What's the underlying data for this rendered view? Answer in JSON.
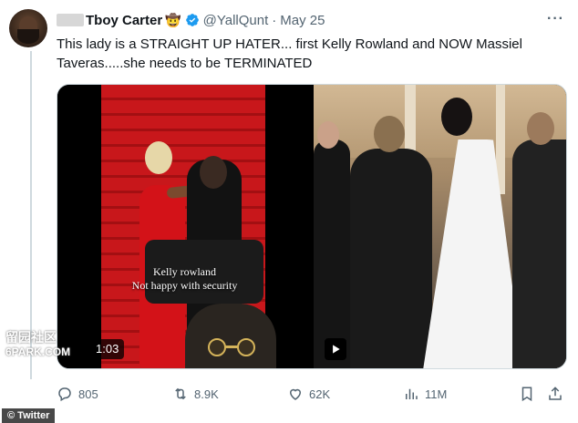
{
  "tweet": {
    "name_suffix": "Tboy Carter",
    "name_emoji": "🤠",
    "handle": "@YallQunt",
    "separator": "·",
    "date": "May 25",
    "text": "This lady is a STRAIGHT UP HATER... first Kelly Rowland and NOW Massiel Taveras.....she needs to be TERMINATED"
  },
  "media": {
    "left_caption_line1": "Kelly rowland",
    "left_caption_line2": "Not happy with security",
    "duration": "1:03",
    "watermark_line1": "留园社区",
    "watermark_line2": "6PARK.COM"
  },
  "actions": {
    "replies": "805",
    "retweets": "8.9K",
    "likes": "62K",
    "views": "11M"
  },
  "credit": "© Twitter",
  "colors": {
    "verified": "#1d9bf0",
    "muted_text": "#536471",
    "carpet": "#c8171b"
  },
  "icons": [
    "more-icon",
    "verified-icon",
    "reply-icon",
    "retweet-icon",
    "like-icon",
    "views-icon",
    "bookmark-icon",
    "share-icon",
    "play-icon"
  ]
}
